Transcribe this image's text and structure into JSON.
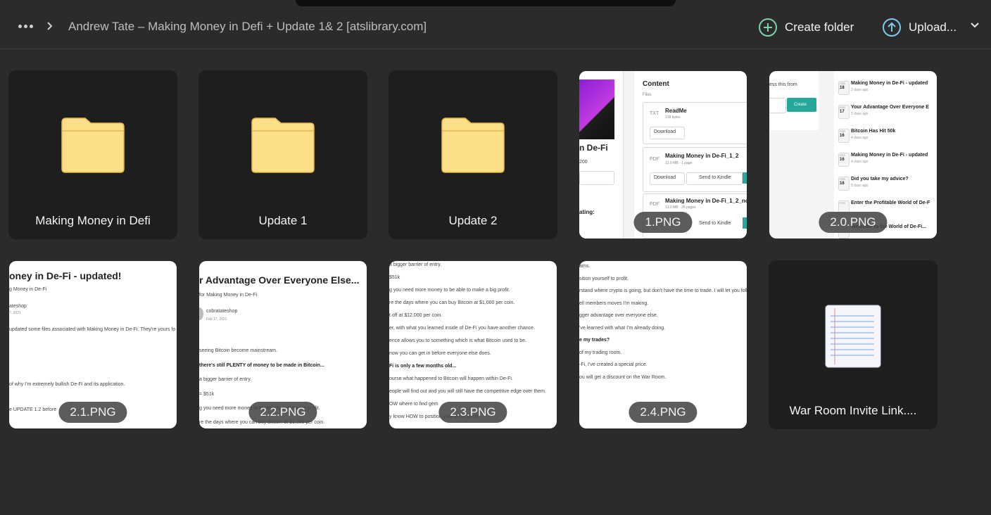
{
  "breadcrumb": {
    "path": "Andrew Tate – Making Money in Defi + Update 1& 2 [atslibrary.com]"
  },
  "toolbar": {
    "create_folder": "Create folder",
    "upload": "Upload...",
    "icons": [
      "more-icon",
      "chevron-right-icon",
      "plus-circle-icon",
      "upload-arrow-icon",
      "chevron-down-icon"
    ],
    "colors": {
      "create_icon": "#7fd1a8",
      "upload_icon": "#7ec8f2",
      "folder": "#fddf8a"
    }
  },
  "items": [
    {
      "name": "Making Money in Defi",
      "type": "folder"
    },
    {
      "name": "Update 1",
      "type": "folder"
    },
    {
      "name": "Update 2",
      "type": "folder"
    },
    {
      "name": "1.PNG",
      "type": "image"
    },
    {
      "name": "2.0.PNG",
      "type": "image"
    },
    {
      "name": "2.1.PNG",
      "type": "image"
    },
    {
      "name": "2.2.PNG",
      "type": "image"
    },
    {
      "name": "2.3.PNG",
      "type": "image"
    },
    {
      "name": "2.4.PNG",
      "type": "image"
    },
    {
      "name": "War Room Invite Link....",
      "type": "text"
    }
  ],
  "thumbs": {
    "t1": {
      "title": "Content",
      "files": "Files",
      "f1_type": "TXT",
      "f1_name": "ReadMe",
      "f1_size": "218 bytes",
      "f1_btn": "Download",
      "f2_type": "PDF",
      "f2_name": "Making Money in De-Fi_1_2",
      "f2_size": "13.0 MB - 1 page",
      "f2_btn": "Download",
      "f2_kindle": "Send to Kindle",
      "f3_type": "PDF",
      "f3_name": "Making Money in De-Fi_1_2_no",
      "f3_size": "13.0 MB - 26 pages",
      "f3_kindle": "Send to Kindle",
      "left_title": "n De-Fi",
      "left_code": "200",
      "rating": "ating:"
    },
    "t20": {
      "access": "ess this from",
      "create": "Create",
      "posts": [
        {
          "m": "FEB",
          "d": "18",
          "title": "Making Money in De-Fi - updated",
          "ago": "2 days ago"
        },
        {
          "m": "FEB",
          "d": "17",
          "title": "Your Advantage Over Everyone E",
          "ago": "3 days ago"
        },
        {
          "m": "FEB",
          "d": "16",
          "title": "Bitcoin Has Hit 50k",
          "ago": "4 days ago"
        },
        {
          "m": "FEB",
          "d": "16",
          "title": "Making Money in De-Fi - updated",
          "ago": "4 days ago"
        },
        {
          "m": "FEB",
          "d": "16",
          "title": "Did you take my advice?",
          "ago": "5 days ago"
        },
        {
          "m": "FEB",
          "d": "",
          "title": "Enter the Profitable World of De-F",
          "ago": ""
        },
        {
          "m": "",
          "d": "",
          "title": "Welcome to the World of De-Fi...",
          "ago": ""
        }
      ]
    },
    "t21": {
      "title": "oney in De-Fi - updated!",
      "sub": "g Money in De-Fi",
      "author": "ateshop",
      "date": "7, 2021",
      "line1": "updated some files associated with Making Money in De-Fi. They're yours fo",
      "line2": "of why I'm extremely bullish De-Fi and its application.",
      "line3": "e UPDATE 1.2 before"
    },
    "t22": {
      "title": "r Advantage Over Everyone Else...",
      "sub": "for Making Money in De-Fi",
      "author": "cobratateshop",
      "date": "Feb 17, 2021",
      "line1": "seeing Bitcoin become mainstream.",
      "line2": "there's still PLENTY of money to be made in Bitcoin...",
      "line3": "a bigger barrier of entry.",
      "line4": "= $51k",
      "line5": "g you need more money to be able to make a big profit.",
      "line6": "re the days where you can buy Bitcoin at $1,000 per coin."
    },
    "t23": {
      "lines": [
        "a bigger barrier of entry.",
        "$51k",
        "g you need more money to be able to make a big profit.",
        "re the days where you can buy Bitcoin at $1,000 per coin.",
        "t off at $12,000 per coin.",
        "er, with what you learned inside of De-Fi you have another chance.",
        "ence allows you to something which is what Bitcoin used to be.",
        "now you can get in before everyone else does.",
        "Fi is only a few months old...",
        "ourse what happened to Bitcoin will happen within De-Fi.",
        "eople will find out and you will still have the competitive edge over them.",
        "OW where to find gem",
        "y know HOW to position yourself to profit."
      ]
    },
    "t24": {
      "lines": [
        "ams.",
        "sition yourself to profit.",
        "rstand where crypto is going, but don't have the time to trade. I will let you follow",
        "ell members moves I'm making.",
        "gger advantage over everyone else.",
        "'ve learned with what I'm already doing.",
        "e my trades?",
        "of my trading room.",
        "-Fi, I've created a special price.",
        "ou will get a discount on the War Room."
      ]
    }
  }
}
